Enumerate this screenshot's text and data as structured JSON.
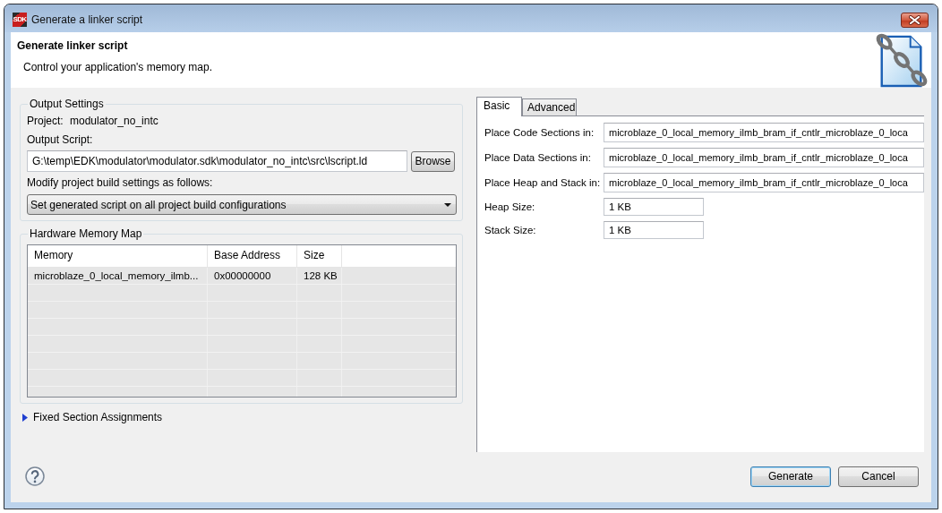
{
  "window": {
    "logo_text": "SDK",
    "title": "Generate a linker script"
  },
  "header": {
    "title": "Generate linker script",
    "description": "Control your application's memory map."
  },
  "output_settings": {
    "legend": "Output Settings",
    "project_label": "Project:",
    "project_value": "modulator_no_intc",
    "script_label": "Output Script:",
    "script_path": "G:\\temp\\EDK\\modulator\\modulator.sdk\\modulator_no_intc\\src\\lscript.ld",
    "browse_button": "Browse",
    "modify_label": "Modify project build settings as follows:",
    "build_setting": "Set generated script on all project build configurations"
  },
  "memory_map": {
    "legend": "Hardware Memory Map",
    "columns": [
      "Memory",
      "Base Address",
      "Size"
    ],
    "rows": [
      {
        "cells": [
          "microblaze_0_local_memory_ilmb...",
          "0x00000000",
          "128 KB"
        ],
        "selected": false
      }
    ]
  },
  "fixed_sections": {
    "label": "Fixed Section Assignments",
    "expanded": false
  },
  "tabs": [
    {
      "label": "Basic",
      "selected": true
    },
    {
      "label": "Advanced",
      "selected": false
    }
  ],
  "basic_fields": [
    {
      "kind": "region",
      "label": "Place Code Sections in:",
      "value": "microblaze_0_local_memory_ilmb_bram_if_cntlr_microblaze_0_loca"
    },
    {
      "kind": "region",
      "label": "Place Data Sections in:",
      "value": "microblaze_0_local_memory_ilmb_bram_if_cntlr_microblaze_0_loca"
    },
    {
      "kind": "region",
      "label": "Place Heap and Stack in:",
      "value": "microblaze_0_local_memory_ilmb_bram_if_cntlr_microblaze_0_loca"
    },
    {
      "kind": "size",
      "label": "Heap Size:",
      "value": "1 KB"
    },
    {
      "kind": "size",
      "label": "Stack Size:",
      "value": "1 KB"
    }
  ],
  "buttons": [
    {
      "label": "Generate",
      "default": true
    },
    {
      "label": "Cancel",
      "default": false
    }
  ]
}
